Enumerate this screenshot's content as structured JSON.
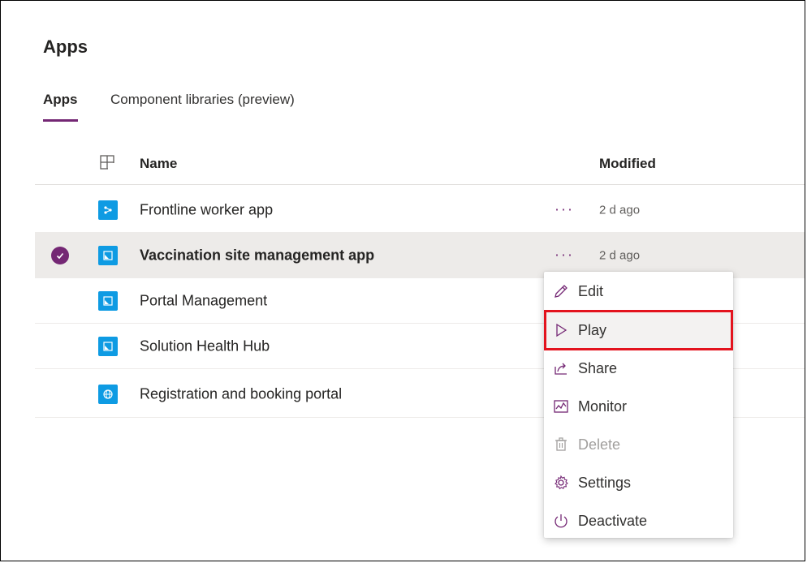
{
  "page": {
    "title": "Apps"
  },
  "tabs": [
    {
      "label": "Apps",
      "active": true
    },
    {
      "label": "Component libraries (preview)",
      "active": false
    }
  ],
  "grid": {
    "columns": {
      "name": "Name",
      "modified": "Modified"
    },
    "rows": [
      {
        "name": "Frontline worker app",
        "modified": "2 d ago",
        "icon": "canvas-app-icon",
        "selected": false,
        "more": "···"
      },
      {
        "name": "Vaccination site management app",
        "modified": "2 d ago",
        "icon": "model-app-icon",
        "selected": true,
        "more": "···"
      },
      {
        "name": "Portal Management",
        "modified": "",
        "icon": "model-app-icon",
        "selected": false
      },
      {
        "name": "Solution Health Hub",
        "modified": "",
        "icon": "model-app-icon",
        "selected": false
      },
      {
        "name": "Registration and booking portal",
        "modified": "",
        "icon": "portal-globe-icon",
        "selected": false
      }
    ]
  },
  "context_menu": {
    "items": [
      {
        "label": "Edit",
        "icon": "pencil-icon",
        "disabled": false
      },
      {
        "label": "Play",
        "icon": "play-icon",
        "disabled": false,
        "highlighted": true
      },
      {
        "label": "Share",
        "icon": "share-icon",
        "disabled": false
      },
      {
        "label": "Monitor",
        "icon": "monitor-icon",
        "disabled": false
      },
      {
        "label": "Delete",
        "icon": "trash-icon",
        "disabled": true
      },
      {
        "label": "Settings",
        "icon": "gear-icon",
        "disabled": false
      },
      {
        "label": "Deactivate",
        "icon": "power-icon",
        "disabled": false
      }
    ]
  },
  "colors": {
    "accent": "#742774",
    "app_icon": "#0e9be3",
    "highlight_box": "#e3131e"
  }
}
